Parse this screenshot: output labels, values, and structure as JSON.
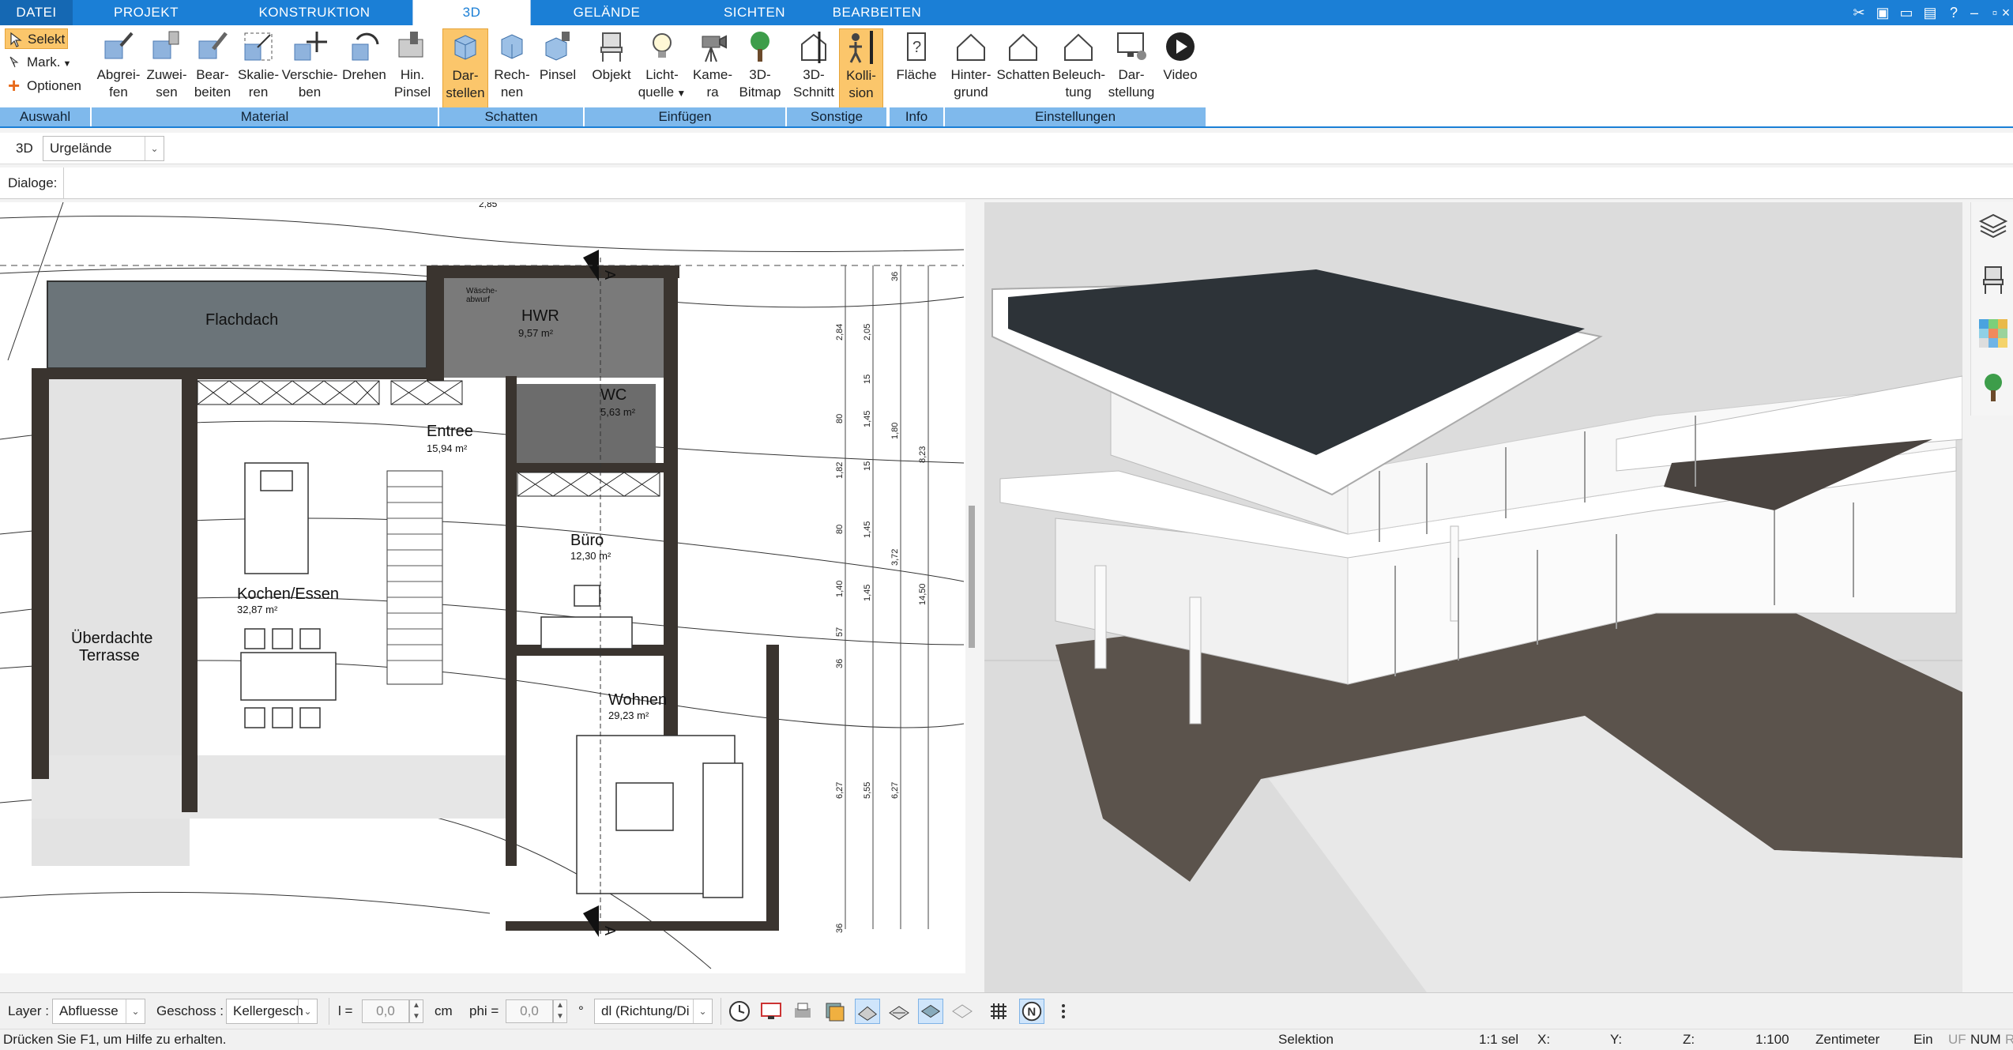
{
  "tabs": [
    "DATEI",
    "PROJEKT",
    "KONSTRUKTION",
    "3D",
    "GELÄNDE",
    "SICHTEN",
    "BEARBEITEN"
  ],
  "ribbon": {
    "auswahl": {
      "selekt": "Selekt",
      "mark": "Mark.",
      "optionen": "Optionen",
      "group": "Auswahl"
    },
    "material": {
      "group": "Material",
      "buttons": [
        {
          "l1": "Abgrei-",
          "l2": "fen"
        },
        {
          "l1": "Zuwei-",
          "l2": "sen"
        },
        {
          "l1": "Bear-",
          "l2": "beiten"
        },
        {
          "l1": "Skalie-",
          "l2": "ren"
        },
        {
          "l1": "Verschie-",
          "l2": "ben"
        },
        {
          "l1": "Drehen",
          "l2": ""
        },
        {
          "l1": "Hin.",
          "l2": "Pinsel"
        }
      ]
    },
    "schatten": {
      "group": "Schatten",
      "buttons": [
        {
          "l1": "Dar-",
          "l2": "stellen"
        },
        {
          "l1": "Rech-",
          "l2": "nen"
        },
        {
          "l1": "Pinsel",
          "l2": ""
        }
      ]
    },
    "einfuegen": {
      "group": "Einfügen",
      "buttons": [
        {
          "l1": "Objekt",
          "l2": ""
        },
        {
          "l1": "Licht-",
          "l2": "quelle"
        },
        {
          "l1": "Kame-",
          "l2": "ra"
        },
        {
          "l1": "3D-",
          "l2": "Bitmap"
        }
      ]
    },
    "sonstige": {
      "group": "Sonstige",
      "buttons": [
        {
          "l1": "3D-",
          "l2": "Schnitt"
        },
        {
          "l1": "Kolli-",
          "l2": "sion"
        }
      ]
    },
    "info": {
      "group": "Info",
      "buttons": [
        {
          "l1": "Fläche",
          "l2": ""
        }
      ]
    },
    "einstellungen": {
      "group": "Einstellungen",
      "buttons": [
        {
          "l1": "Hinter-",
          "l2": "grund"
        },
        {
          "l1": "Schatten",
          "l2": ""
        },
        {
          "l1": "Beleuch-",
          "l2": "tung"
        },
        {
          "l1": "Dar-",
          "l2": "stellung"
        },
        {
          "l1": "Video",
          "l2": ""
        }
      ]
    }
  },
  "bar3d": {
    "label": "3D",
    "combo_value": "Urgelände"
  },
  "dialoge_label": "Dialoge:",
  "plan": {
    "rooms": [
      {
        "name": "Flachdach",
        "area": ""
      },
      {
        "name": "HWR",
        "area": "9,57 m²"
      },
      {
        "name": "WC",
        "area": "5,63 m²"
      },
      {
        "name": "Entree",
        "area": "15,94 m²"
      },
      {
        "name": "Büro",
        "area": "12,30 m²"
      },
      {
        "name": "Kochen/Essen",
        "area": "32,87 m²"
      },
      {
        "name": "Wohnen",
        "area": "29,23 m²"
      },
      {
        "name": "Überdachte",
        "area": "Terrasse"
      }
    ],
    "small_labels": [
      "Wäsche-",
      "abwurf"
    ],
    "section_marks": [
      "A",
      "A"
    ],
    "top_dim": "2,85",
    "dims_col1": [
      "2,84",
      "80",
      "1,82",
      "80",
      "1,40",
      "57",
      "36",
      "6,27",
      "36"
    ],
    "dims_col2": [
      "2,05",
      "15",
      "1,45",
      "15",
      "1,45",
      "1,45",
      "5,55"
    ],
    "dims_col3": [
      "36",
      "1,80",
      "3,72",
      "6,27"
    ],
    "dims_col4": [
      "8,23",
      "14,50"
    ]
  },
  "bottombar": {
    "layer_label": "Layer :",
    "layer_value": "Abfluesse",
    "geschoss_label": "Geschoss :",
    "geschoss_value": "Kellergesch",
    "l_label": "l =",
    "l_value": "0,0",
    "l_unit": "cm",
    "phi_label": "phi =",
    "phi_value": "0,0",
    "phi_unit": "°",
    "direction_value": "dl (Richtung/Di"
  },
  "status": {
    "help": "Drücken Sie F1, um Hilfe zu erhalten.",
    "mode": "Selektion",
    "sel": "1:1 sel",
    "x": "X:",
    "y": "Y:",
    "z": "Z:",
    "scale": "1:100",
    "unit": "Zentimeter",
    "ein": "Ein",
    "uf": "UF",
    "num": "NUM",
    "r": "R"
  },
  "colors": {
    "accent": "#1b7fd6",
    "group_label": "#7fb9ec",
    "active_button": "#fbc66b",
    "roof": "#2d3338",
    "deck": "#5b534c"
  }
}
